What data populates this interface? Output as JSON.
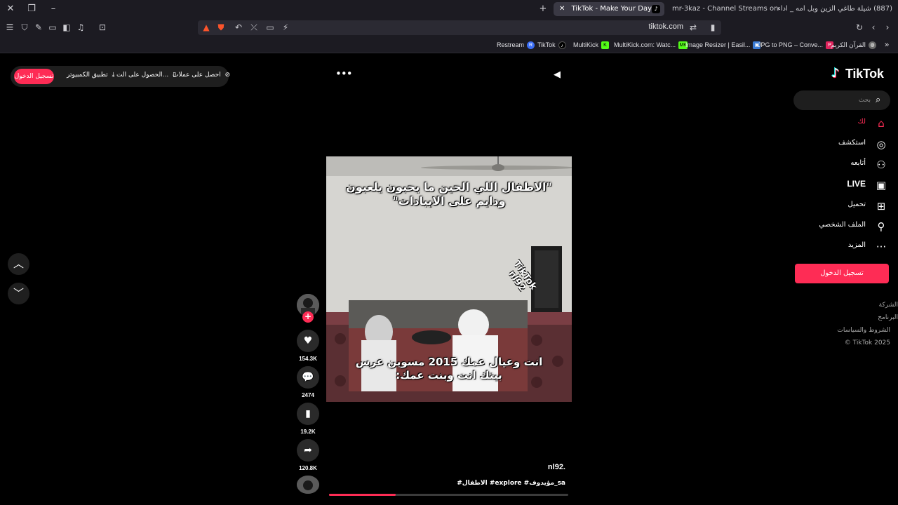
{
  "browser": {
    "tabs": [
      {
        "title": "(887) شيلة طاغي الزين وبل امه _ اداء",
        "active": false
      },
      {
        "title": "mr-3kaz - Channel Streams on Kick",
        "active": false
      },
      {
        "title": "TikTok - Make Your Day",
        "active": true
      }
    ],
    "url": "tiktok.com",
    "bookmarks": [
      {
        "label": "Restream",
        "color": "#3b6ef5",
        "icon": "restream-icon"
      },
      {
        "label": "TikTok",
        "color": "#000000",
        "icon": "tiktok-icon"
      },
      {
        "label": "MultiKick",
        "color": "#53fc18",
        "icon": "kick-icon"
      },
      {
        "label": "MultiKick.com: Watc...",
        "color": "#53fc18",
        "icon": "multikick-icon"
      },
      {
        "label": "Image Resizer | Easil...",
        "color": "#3a7bd5",
        "icon": "image-icon"
      },
      {
        "label": "JPG to PNG – Conve...",
        "color": "#e0245e",
        "icon": "png-icon"
      },
      {
        "label": "القرآن الكريم",
        "color": "#6a6a6a",
        "icon": "globe-icon"
      }
    ]
  },
  "topbar": {
    "login": "تسجيل الدخول",
    "desktop_app": "تطبيق الكمبيوتر",
    "get_app": "الحصول على الت...",
    "get_coins": "احصل على عملات"
  },
  "sidebar": {
    "logo": "TikTok",
    "search_placeholder": "بحث",
    "nav": [
      {
        "label": "لك",
        "icon": "home-icon",
        "active": true
      },
      {
        "label": "استكشف",
        "icon": "compass-icon",
        "active": false
      },
      {
        "label": "أتابعه",
        "icon": "following-icon",
        "active": false
      },
      {
        "label": "LIVE",
        "icon": "live-icon",
        "active": false
      },
      {
        "label": "تحميل",
        "icon": "upload-icon",
        "active": false
      },
      {
        "label": "الملف الشخصي",
        "icon": "profile-icon",
        "active": false
      },
      {
        "label": "المزيد",
        "icon": "more-icon",
        "active": false
      }
    ],
    "login_button": "تسجيل الدخول",
    "footer": [
      "الشركة",
      "البرنامج",
      "الشروط والسياسات",
      "© TikTok 2025"
    ]
  },
  "video": {
    "top_caption": "\"الاطفال اللي الحين ما يحبون يلعبون ودايم على الايبادات\"",
    "bottom_caption": "انت وعيال عمك 2015 مسوين عرس بيتك انت وبنت عمك:",
    "watermark": "TikTok nl92",
    "author": "nl92.",
    "description": "#الاطفال #explore #مؤيدوف_sa",
    "progress": 0.28
  },
  "actions": {
    "likes": "154.3K",
    "comments": "2474",
    "saves": "19.2K",
    "shares": "120.8K"
  }
}
